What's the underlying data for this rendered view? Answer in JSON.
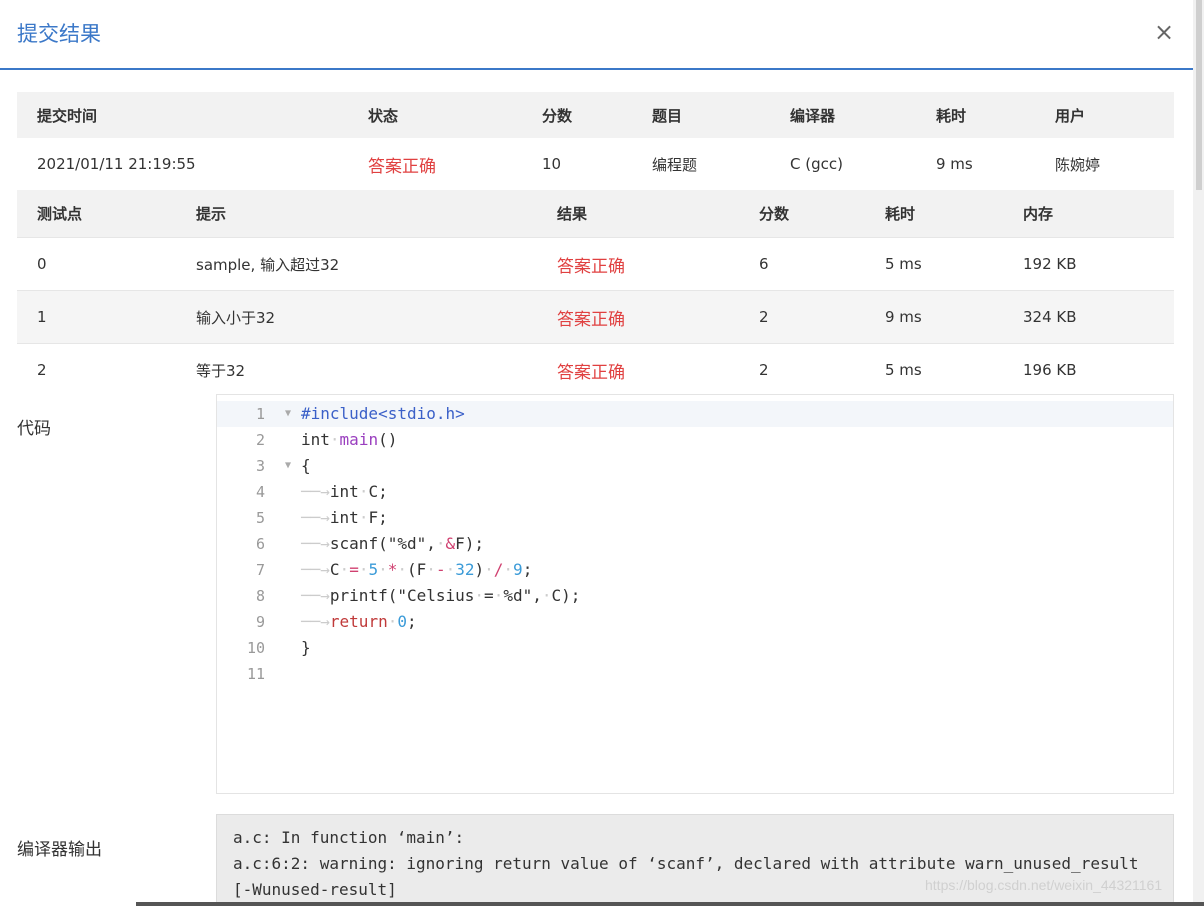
{
  "dialog": {
    "title": "提交结果",
    "close_label": "×"
  },
  "summary": {
    "headers": [
      "提交时间",
      "状态",
      "分数",
      "题目",
      "编译器",
      "耗时",
      "用户"
    ],
    "row": [
      "2021/01/11 21:19:55",
      "答案正确",
      "10",
      "编程题",
      "C (gcc)",
      "9 ms",
      "陈婉婷"
    ]
  },
  "tests": {
    "headers": [
      "测试点",
      "提示",
      "结果",
      "分数",
      "耗时",
      "内存"
    ],
    "rows": [
      [
        "0",
        "sample, 输入超过32",
        "答案正确",
        "6",
        "5 ms",
        "192 KB"
      ],
      [
        "1",
        "输入小于32",
        "答案正确",
        "2",
        "9 ms",
        "324 KB"
      ],
      [
        "2",
        "等于32",
        "答案正确",
        "2",
        "5 ms",
        "196 KB"
      ]
    ]
  },
  "code": {
    "label": "代码",
    "line_numbers": [
      "1",
      "2",
      "3",
      "4",
      "5",
      "6",
      "7",
      "8",
      "9",
      "10",
      "11"
    ],
    "lines": [
      "#include<stdio.h>",
      "int main()",
      "{",
      "int C;",
      "int F;",
      "scanf(\"%d\", &F);",
      "C = 5 * (F - 32) / 9;",
      "printf(\"Celsius = %d\", C);",
      "return 0;",
      "}",
      ""
    ]
  },
  "compiler": {
    "label": "编译器输出",
    "lines": [
      "a.c: In function ‘main’:",
      "a.c:6:2: warning: ignoring return value of ‘scanf’, declared with attribute warn_unused_result",
      "[-Wunused-result]"
    ]
  },
  "watermark": "https://blog.csdn.net/weixin_44321161",
  "colors": {
    "accent": "#3b78c8",
    "success_text": "#e04040"
  }
}
